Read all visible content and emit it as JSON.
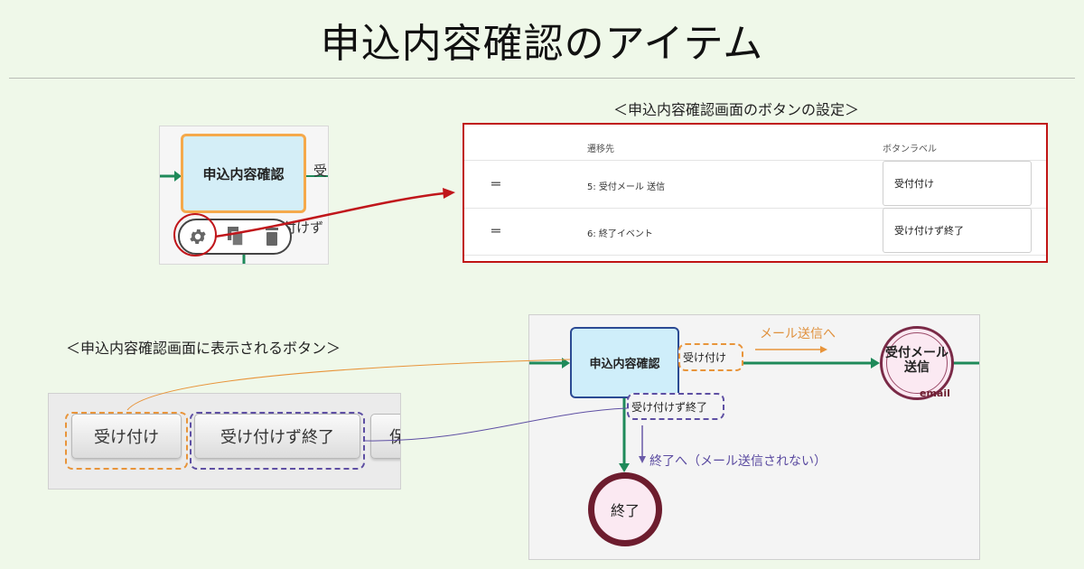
{
  "title": "申込内容確認のアイテム",
  "flow_node_crop": {
    "node_label": "申込内容確認",
    "edge_label_partial": "受",
    "edge_label_partial2": "付けず",
    "toolbar_icons": [
      "gear-icon",
      "copy-icon",
      "trash-icon"
    ]
  },
  "settings_section": {
    "caption": "＜申込内容確認画面のボタンの設定＞",
    "columns": [
      "遷移先",
      "ボタンラベル"
    ],
    "rows": [
      {
        "drag": "═",
        "destination": "5: 受付メール 送信",
        "label": "受付付け"
      },
      {
        "drag": "═",
        "destination": "6: 終了イベント",
        "label": "受け付けず終了"
      }
    ]
  },
  "screen_section": {
    "caption": "＜申込内容確認画面に表示されるボタン＞",
    "buttons": [
      "受け付け",
      "受け付けず終了",
      "保"
    ]
  },
  "flow_diagram": {
    "node_label": "申込内容確認",
    "edge_accept_label": "受け付け",
    "edge_reject_label": "受け付けず終了",
    "note_to_mail": "メール送信へ",
    "note_to_end": "終了へ（メール送信されない）",
    "mail_node_line1": "受付メール",
    "mail_node_line2": "送信",
    "mail_node_badge": "email",
    "end_node_label": "終了"
  },
  "colors": {
    "background": "#eff8e9",
    "accent_red": "#c01414",
    "orange_dash": "#e8943a",
    "purple_dash": "#5e4fa3",
    "flow_green": "#1f8a5a",
    "end_ring": "#6d1c2e"
  }
}
